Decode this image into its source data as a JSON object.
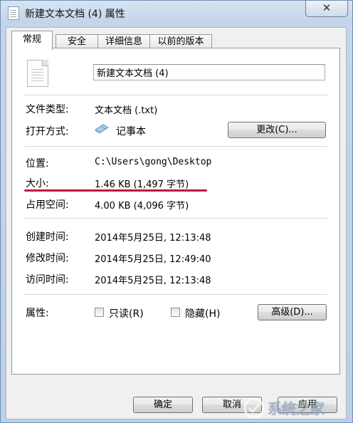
{
  "window": {
    "title": "新建文本文档 (4) 属性",
    "close_label": "✕"
  },
  "tabs": [
    {
      "label": "常规",
      "active": true
    },
    {
      "label": "安全",
      "active": false
    },
    {
      "label": "详细信息",
      "active": false
    },
    {
      "label": "以前的版本",
      "active": false
    }
  ],
  "file": {
    "name": "新建文本文档 (4)"
  },
  "rows": {
    "type": {
      "label": "文件类型:",
      "value": "文本文档 (.txt)"
    },
    "open_with": {
      "label": "打开方式:",
      "value": "记事本",
      "button": "更改(C)..."
    },
    "location": {
      "label": "位置:",
      "value": "C:\\Users\\gong\\Desktop"
    },
    "size": {
      "label": "大小:",
      "value": "1.46 KB (1,497 字节)"
    },
    "disk_size": {
      "label": "占用空间:",
      "value": "4.00 KB (4,096 字节)"
    },
    "created": {
      "label": "创建时间:",
      "value": "2014年5月25日, 12:13:48"
    },
    "modified": {
      "label": "修改时间:",
      "value": "2014年5月25日, 12:49:40"
    },
    "accessed": {
      "label": "访问时间:",
      "value": "2014年5月25日, 12:13:48"
    },
    "attributes": {
      "label": "属性:",
      "readonly": "只读(R)",
      "hidden": "隐藏(H)",
      "advanced": "高级(D)..."
    }
  },
  "footer": {
    "ok": "确定",
    "cancel": "取消",
    "apply": "应用"
  },
  "watermark": {
    "text": "系统之家"
  },
  "colors": {
    "highlight_underline": "#c0133f",
    "title_gradient": "#c4d5e9"
  }
}
